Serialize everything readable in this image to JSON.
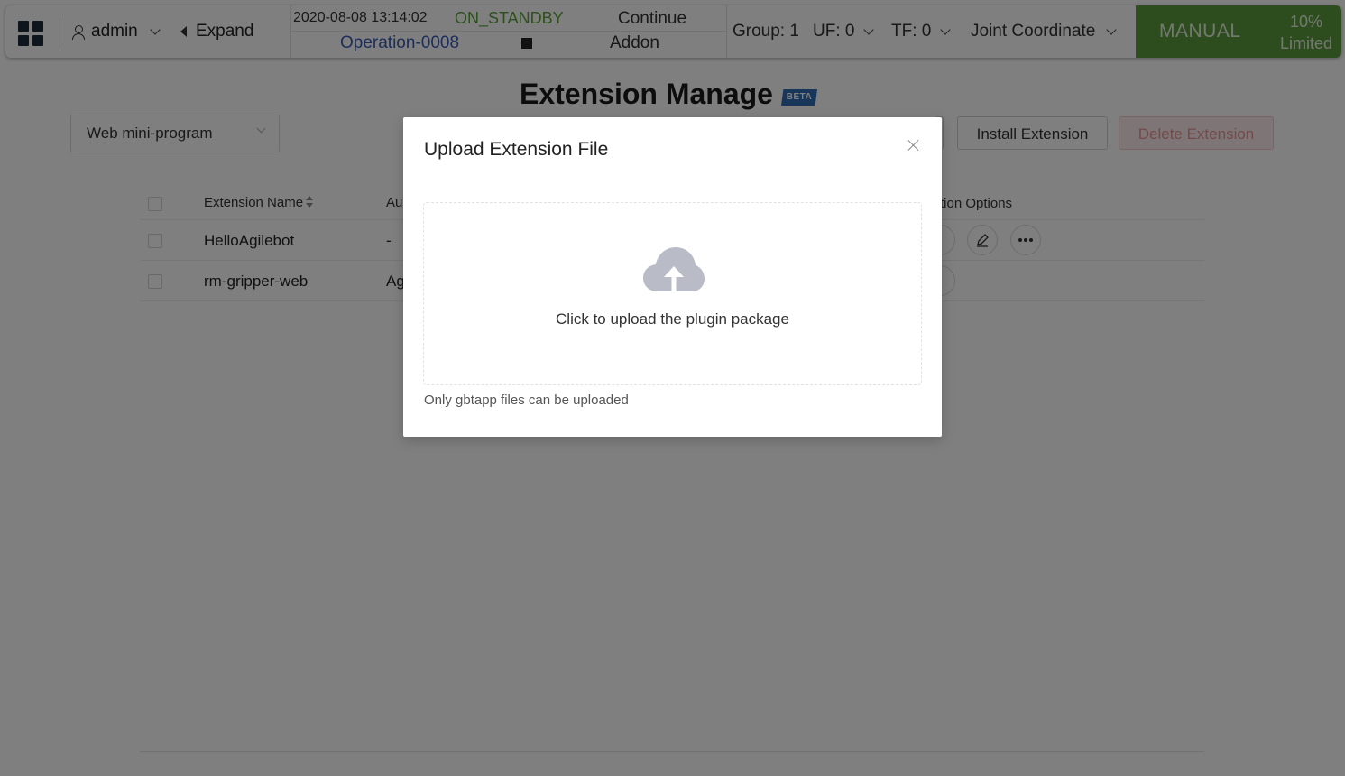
{
  "topbar": {
    "user": "admin",
    "expand_label": "Expand",
    "datetime": "2020-08-08 13:14:02",
    "state": "ON_STANDBY",
    "continue_label": "Continue",
    "operation": "Operation-0008",
    "addon_label": "Addon",
    "group": "Group: 1",
    "uf": "UF: 0",
    "tf": "TF: 0",
    "coordinate": "Joint Coordinate",
    "mode": "MANUAL",
    "speed": "10%",
    "speed_status": "Limited"
  },
  "page": {
    "title": "Extension Manage",
    "badge": "BETA",
    "filter_value": "Web mini-program",
    "install_button": "Install Extension",
    "delete_button": "Delete Extension"
  },
  "table": {
    "columns": [
      "Extension Name",
      "Au",
      "tion Options"
    ],
    "rows": [
      {
        "name": "HelloAgilebot",
        "author": "-"
      },
      {
        "name": "rm-gripper-web",
        "author": "Ag"
      }
    ]
  },
  "modal": {
    "title": "Upload Extension File",
    "dropzone_text": "Click to upload the plugin package",
    "hint": "Only gbtapp files can be uploaded"
  },
  "colors": {
    "manual_green": "#5a9a3c",
    "standby_green": "#5aa03a",
    "operation_blue": "#3b5bb5",
    "badge_blue": "#2f6db5",
    "delete_red": "#e89393"
  }
}
